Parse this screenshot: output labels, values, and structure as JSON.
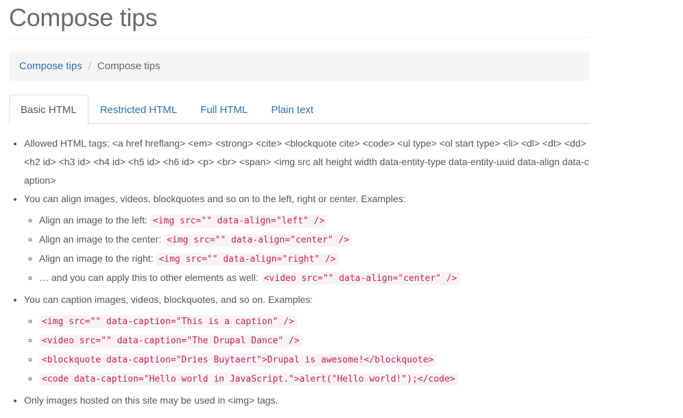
{
  "page": {
    "title": "Compose tips"
  },
  "breadcrumb": {
    "link_label": "Compose tips",
    "separator": "/",
    "current_label": "Compose tips"
  },
  "tabs": [
    {
      "label": "Basic HTML",
      "active": true
    },
    {
      "label": "Restricted HTML",
      "active": false
    },
    {
      "label": "Full HTML",
      "active": false
    },
    {
      "label": "Plain text",
      "active": false
    }
  ],
  "tips": {
    "allowed_tags": "Allowed HTML tags: <a href hreflang> <em> <strong> <cite> <blockquote cite> <code> <ul type> <ol start type> <li> <dl> <dt> <dd> <h2 id> <h3 id> <h4 id> <h5 id> <h6 id> <p> <br> <span> <img src alt height width data-entity-type data-entity-uuid data-align data-caption>",
    "align_intro": "You can align images, videos, blockquotes and so on to the left, right or center. Examples:",
    "align_examples": [
      {
        "label": "Align an image to the left: ",
        "code": "<img src=\"\" data-align=\"left\" />"
      },
      {
        "label": "Align an image to the center: ",
        "code": "<img src=\"\" data-align=\"center\" />"
      },
      {
        "label": "Align an image to the right: ",
        "code": "<img src=\"\" data-align=\"right\" />"
      },
      {
        "label": "… and you can apply this to other elements as well: ",
        "code": "<video src=\"\" data-align=\"center\" />"
      }
    ],
    "caption_intro": "You can caption images, videos, blockquotes, and so on. Examples:",
    "caption_examples": [
      "<img src=\"\" data-caption=\"This is a caption\" />",
      "<video src=\"\" data-caption=\"The Drupal Dance\" />",
      "<blockquote data-caption=\"Dries Buytaert\">Drupal is awesome!</blockquote>",
      "<code data-caption=\"Hello world in JavaScript.\">alert(\"Hello world!\");</code>"
    ],
    "images_note": "Only images hosted on this site may be used in <img> tags."
  },
  "colors": {
    "link": "#2a6fad",
    "code_text": "#c7254e",
    "code_bg": "#f9f2f4"
  }
}
